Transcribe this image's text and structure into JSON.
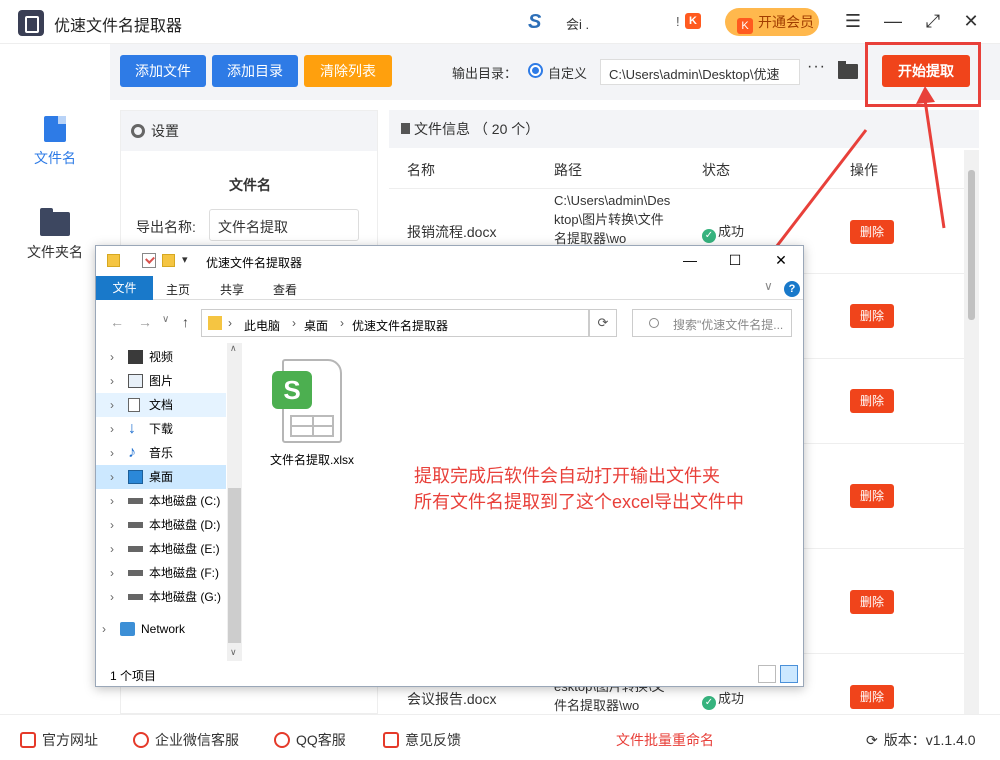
{
  "app": {
    "title": "优速文件名提取器",
    "user_name": "会i .",
    "vip_label": "开通会员",
    "vip_icon": "K"
  },
  "window_controls": {
    "menu": "☰",
    "minimize": "—",
    "maximize": "⤢",
    "close": "✕"
  },
  "sidenav": {
    "items": [
      {
        "label": "文件名",
        "icon": "file-icon",
        "active": true
      },
      {
        "label": "文件夹名",
        "icon": "folder-icon",
        "active": false
      }
    ]
  },
  "toolbar": {
    "add_file": "添加文件",
    "add_dir": "添加目录",
    "clear_list": "清除列表",
    "output_label": "输出目录：",
    "radio_label": "自定义",
    "output_path": "C:\\Users\\admin\\Desktop\\优速",
    "more": "···",
    "start": "开始提取",
    "colors": {
      "blue": "#2e7be6",
      "orange": "#ffa00d",
      "red": "#f0441b"
    }
  },
  "settings": {
    "header": "设置",
    "section": "文件名",
    "export_label": "导出名称:",
    "export_value": "文件名提取"
  },
  "fileinfo": {
    "header": "文件信息 （ 20 个）",
    "columns": [
      "名称",
      "路径",
      "状态",
      "操作"
    ],
    "rows": [
      {
        "name": "报销流程.docx",
        "path": "C:\\Users\\admin\\Desktop\\图片转换\\文件名提取器\\wo",
        "status": "成功",
        "action": "删除"
      },
      {
        "name": "",
        "path": "",
        "status": "",
        "action": "删除"
      },
      {
        "name": "",
        "path": "",
        "status": "",
        "action": "删除"
      },
      {
        "name": "",
        "path": "",
        "status": "",
        "action": "删除"
      },
      {
        "name": "",
        "path": "",
        "status": "",
        "action": "删除"
      },
      {
        "name": "会议报告.docx",
        "path": "esktop\\图片转换\\文件名提取器\\wo",
        "status": "成功",
        "action": "删除"
      }
    ]
  },
  "statusbar": {
    "website": "官方网址",
    "wechat": "企业微信客服",
    "qq": "QQ客服",
    "feedback": "意见反馈",
    "rename": "文件批量重命名",
    "version": "版本：v1.1.4.0"
  },
  "explorer": {
    "title": "优速文件名提取器",
    "ribbon": {
      "file": "文件",
      "home": "主页",
      "share": "共享",
      "view": "查看"
    },
    "breadcrumb": [
      "此电脑",
      "桌面",
      "优速文件名提取器"
    ],
    "search_placeholder": "搜索\"优速文件名提...",
    "tree": [
      {
        "label": "视频",
        "icon": "video-icon"
      },
      {
        "label": "图片",
        "icon": "picture-icon"
      },
      {
        "label": "文档",
        "icon": "document-icon"
      },
      {
        "label": "下载",
        "icon": "download-icon"
      },
      {
        "label": "音乐",
        "icon": "music-icon"
      },
      {
        "label": "桌面",
        "icon": "desktop-icon"
      },
      {
        "label": "本地磁盘 (C:)",
        "icon": "drive-c-icon"
      },
      {
        "label": "本地磁盘 (D:)",
        "icon": "drive-icon"
      },
      {
        "label": "本地磁盘 (E:)",
        "icon": "drive-icon"
      },
      {
        "label": "本地磁盘 (F:)",
        "icon": "drive-icon"
      },
      {
        "label": "本地磁盘 (G:)",
        "icon": "drive-icon"
      },
      {
        "label": "Network",
        "icon": "network-icon"
      }
    ],
    "file": {
      "name": "文件名提取.xlsx",
      "badge": "S"
    },
    "item_count": "1 个项目"
  },
  "annotation": {
    "line1": "提取完成后软件会自动打开输出文件夹",
    "line2": "所有文件名提取到了这个excel导出文件中"
  }
}
